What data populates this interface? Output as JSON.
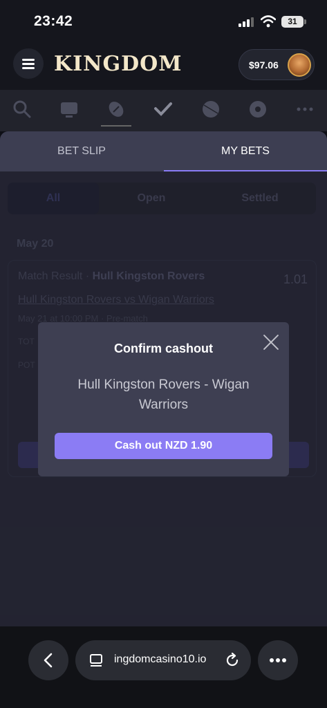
{
  "status_bar": {
    "time": "23:42",
    "battery_level": "31",
    "icons": [
      "signal-icon",
      "wifi-icon",
      "battery-icon"
    ]
  },
  "header": {
    "logo_text": "KINGDOM",
    "balance": "$97.06",
    "icons": [
      "menu-icon",
      "avatar"
    ]
  },
  "sports_nav": {
    "icons": [
      "search-icon",
      "live-icon",
      "football-icon",
      "checkmark-icon",
      "basketball-icon",
      "soccer-icon",
      "more-icon"
    ],
    "active_index": 2
  },
  "bet_panel": {
    "tabs": [
      {
        "label": "BET SLIP",
        "active": false
      },
      {
        "label": "MY BETS",
        "active": true
      }
    ],
    "filters": [
      {
        "label": "All",
        "active": true
      },
      {
        "label": "Open",
        "active": false
      },
      {
        "label": "Settled",
        "active": false
      }
    ],
    "date_label": "May 20",
    "bet": {
      "market": "Match Result",
      "selection": "Hull Kingston Rovers",
      "odds": "1.01",
      "match": "Hull Kingston Rovers vs Wigan Warriors",
      "meta": "May 21 at 10:00 PM · Pre-match",
      "row1_label": "TOT",
      "row2_label": "POT"
    }
  },
  "modal": {
    "title": "Confirm cashout",
    "description": "Hull Kingston Rovers - Wigan Warriors",
    "button_label": "Cash out  NZD 1.90"
  },
  "browser": {
    "url": "ingdomcasino10.io"
  },
  "colors": {
    "accent": "#8b7cf4",
    "sheet_bg": "#2b2c3d",
    "modal_bg": "#3e3f52",
    "app_bg": "#15161d"
  }
}
